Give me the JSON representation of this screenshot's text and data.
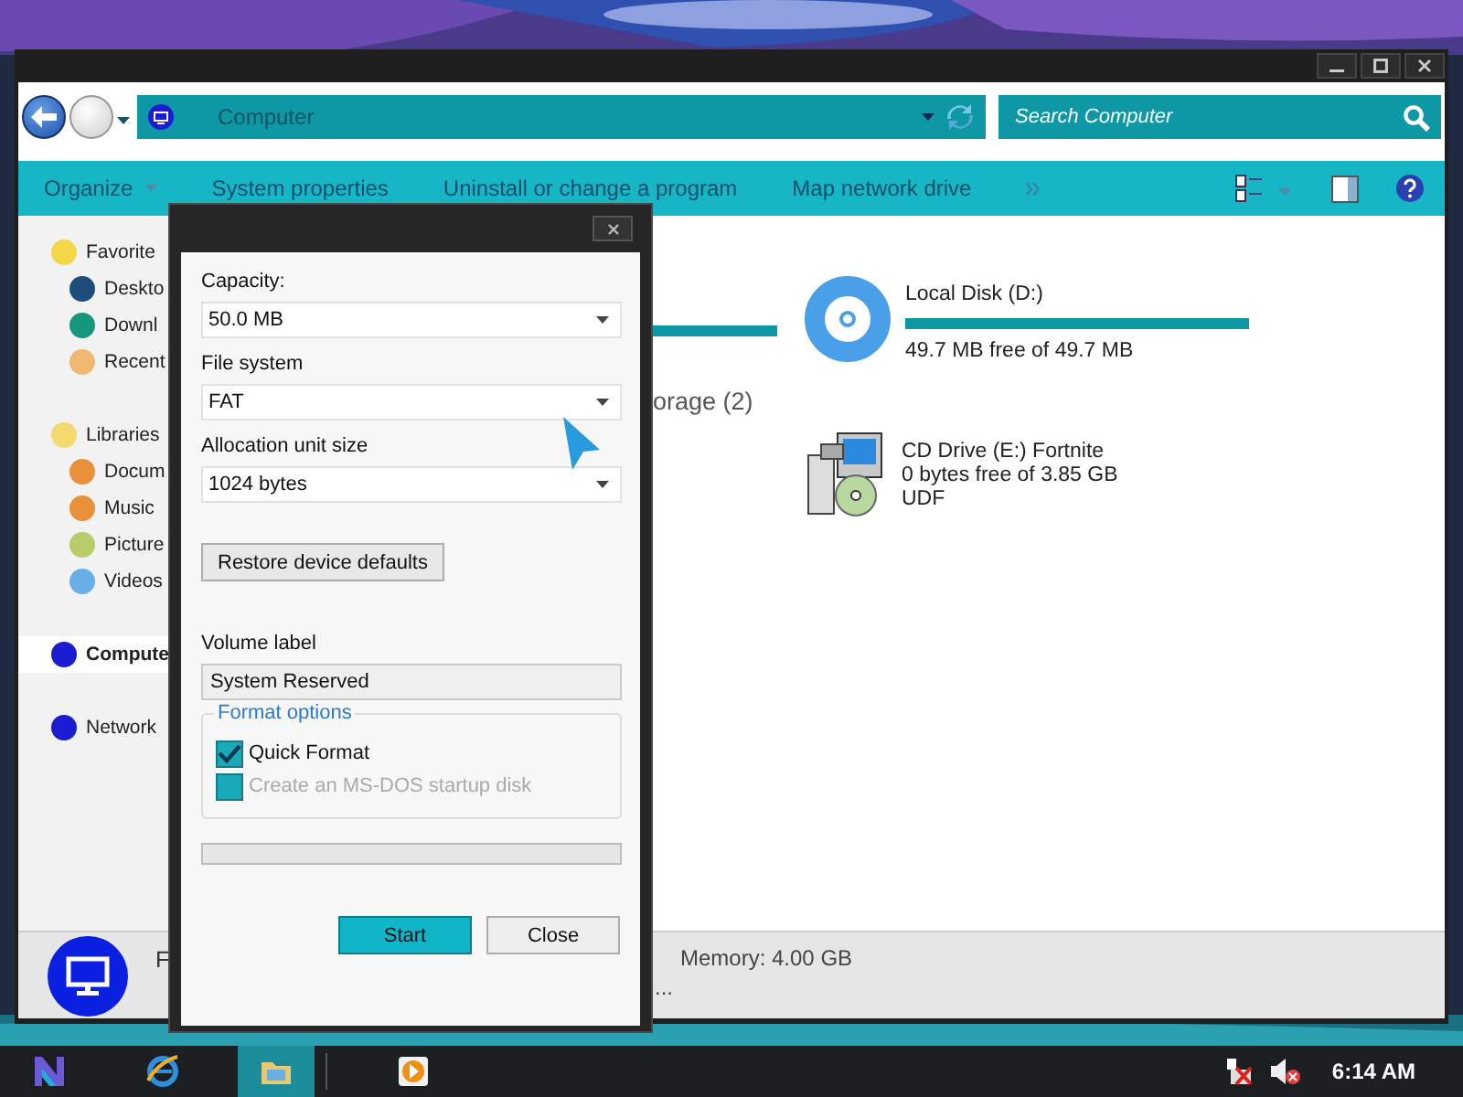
{
  "explorer": {
    "address": {
      "location": "Computer"
    },
    "search": {
      "placeholder": "Search Computer"
    },
    "commands": [
      {
        "label": "Organize",
        "dropdown": true
      },
      {
        "label": "System properties",
        "dropdown": false
      },
      {
        "label": "Uninstall or change a program",
        "dropdown": false
      },
      {
        "label": "Map network drive",
        "dropdown": false
      }
    ],
    "sidebar": [
      {
        "label": "Favorite",
        "selected": false,
        "color": "#f5d84a",
        "children": [
          {
            "label": "Deskto",
            "selected": false,
            "color": "#1d4e7a"
          },
          {
            "label": "Downl",
            "selected": false,
            "color": "#17967e"
          },
          {
            "label": "Recent",
            "selected": false,
            "color": "#f0b870"
          }
        ]
      },
      {
        "label": "Libraries",
        "selected": false,
        "color": "#f5d870",
        "children": [
          {
            "label": "Docum",
            "selected": false,
            "color": "#e8903a"
          },
          {
            "label": "Music",
            "selected": false,
            "color": "#e8903a"
          },
          {
            "label": "Picture",
            "selected": false,
            "color": "#b8cc6a"
          },
          {
            "label": "Videos",
            "selected": false,
            "color": "#6aaee8"
          }
        ]
      },
      {
        "label": "Compute",
        "selected": true,
        "color": "#1b1bd0"
      },
      {
        "label": "Network",
        "selected": false,
        "color": "#1b1bd0"
      }
    ],
    "hard_disks": [
      {
        "kind": "bar",
        "level": 1
      },
      {
        "kind": "disk",
        "name": "Local Disk (D:)",
        "free": "49.7 MB free of 49.7 MB",
        "level": 1
      }
    ],
    "group_heading": "orage (2)",
    "removable": [
      {
        "kind": "cd",
        "name": "CD Drive (E:) Fortnite",
        "free": "0 bytes free of 3.85 GB",
        "filesystem": "UDF"
      }
    ],
    "details": {
      "name": "F",
      "memory": "Memory:  4.00 GB",
      "more": "..."
    }
  },
  "dialog": {
    "fields": [
      {
        "label": "Capacity:",
        "value": "50.0 MB"
      },
      {
        "label": "File system",
        "value": "FAT"
      },
      {
        "label": "Allocation unit size",
        "value": "1024 bytes"
      }
    ],
    "restore_button": "Restore device defaults",
    "volume_label": {
      "label": "Volume label",
      "value": "System Reserved"
    },
    "format_options": {
      "title": "Format options",
      "options": [
        {
          "label": "Quick Format",
          "checked": true,
          "disabled": false
        },
        {
          "label": "Create an MS-DOS startup disk",
          "checked": false,
          "disabled": true
        }
      ]
    },
    "progress": {
      "level": 0
    },
    "buttons": [
      {
        "label": "Start",
        "default": true
      },
      {
        "label": "Close",
        "default": false
      }
    ]
  },
  "taskbar": {
    "apps": [
      {
        "kind": "logo",
        "selected": false
      },
      {
        "kind": "browser",
        "selected": false
      },
      {
        "kind": "folder",
        "selected": true
      },
      {
        "kind": "media",
        "selected": false
      }
    ],
    "clock": "6:14 AM"
  }
}
